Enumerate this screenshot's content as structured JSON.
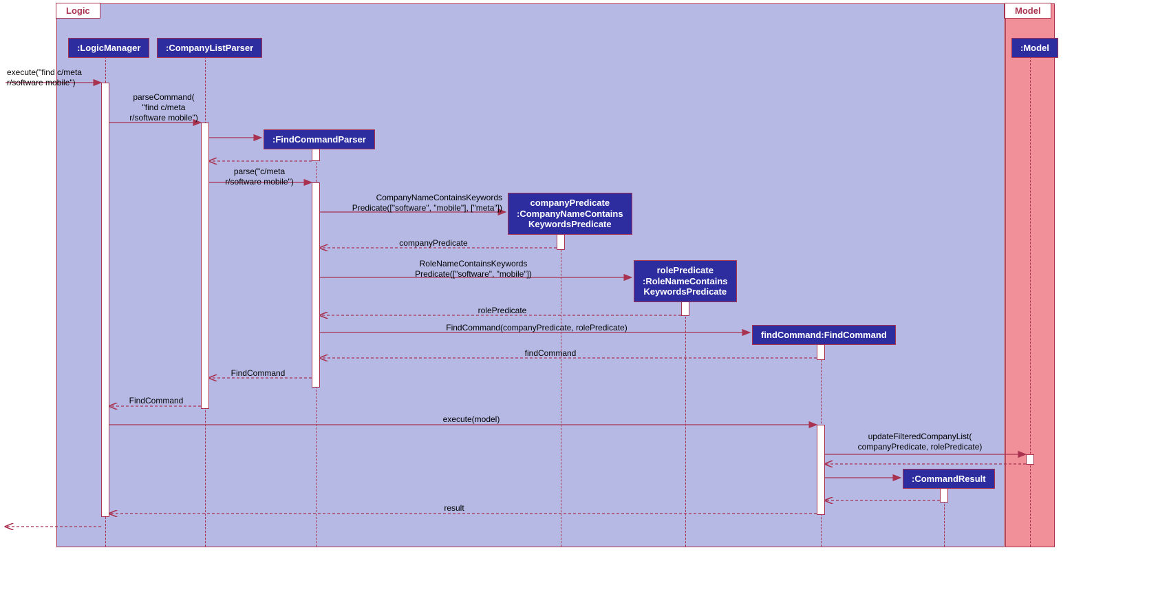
{
  "frames": {
    "logic": "Logic",
    "model": "Model"
  },
  "participants": {
    "logicManager": ":LogicManager",
    "companyListParser": ":CompanyListParser",
    "findCommandParser": ":FindCommandParser",
    "companyPredicate": "companyPredicate\n:CompanyNameContains\nKeywordsPredicate",
    "rolePredicate": "rolePredicate\n:RoleNameContains\nKeywordsPredicate",
    "findCommand": "findCommand:FindCommand",
    "commandResult": ":CommandResult",
    "model": ":Model"
  },
  "messages": {
    "execute": "execute(\"find c/meta\nr/software mobile\")",
    "parseCommand": "parseCommand(\n\"find c/meta\nr/software mobile\")",
    "parse": "parse(\"c/meta\nr/software mobile\")",
    "companyNameContains": "CompanyNameContainsKeywords\nPredicate([\"software\", \"mobile\"], [\"meta\"])",
    "companyPredicateReturn": "companyPredicate",
    "roleNameContains": "RoleNameContainsKeywords\nPredicate([\"software\", \"mobile\"])",
    "rolePredicateReturn": "rolePredicate",
    "findCommandCreate": "FindCommand(companyPredicate, rolePredicate)",
    "findCommandReturn": "findCommand",
    "findCommandReturn2": "FindCommand",
    "findCommandReturn3": "FindCommand",
    "executeModel": "execute(model)",
    "updateFiltered": "updateFilteredCompanyList(\ncompanyPredicate, rolePredicate)",
    "result": "result"
  }
}
